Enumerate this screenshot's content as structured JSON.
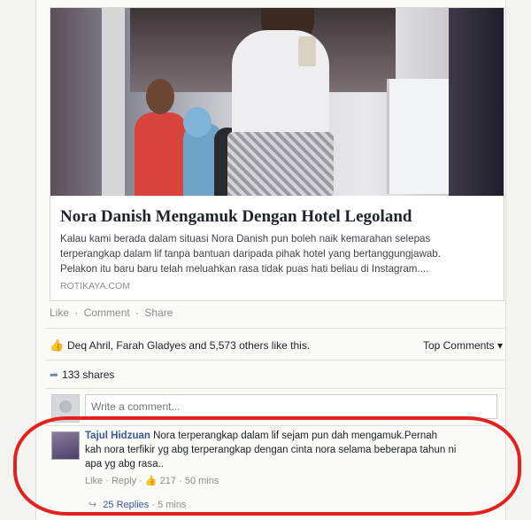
{
  "post": {
    "link_preview": {
      "title": "Nora Danish Mengamuk Dengan Hotel Legoland",
      "description_lines": [
        "Kalau kami berada dalam situasi Nora Danish pun boleh naik kemarahan selepas",
        "terperangkap dalam lif tanpa bantuan daripada pihak hotel yang bertanggungjawab.",
        "Pelakon itu baru baru telah meluahkan rasa tidak puas hati beliau di Instagram...."
      ],
      "domain": "ROTIKAYA.COM"
    },
    "actions": {
      "like": "Like",
      "comment": "Comment",
      "share": "Share",
      "separator": "·"
    },
    "likes_summary": "Deq Ahril, Farah Gladyes and 5,573 others like this.",
    "top_comments_label": "Top Comments ▾",
    "shares": "133 shares",
    "write_comment_placeholder": "Write a comment..."
  },
  "comment": {
    "author": "Tajul Hidzuan",
    "text_lines": [
      "Nora terperangkap dalam lif sejam pun dah mengamuk.Pernah",
      "kah nora terfikir yg abg terperangkap dengan cinta nora selama beberapa tahun ni",
      "apa yg abg rasa.."
    ],
    "like": "Like",
    "reply": "Reply",
    "like_count": "217",
    "time": "50 mins",
    "separator": "·"
  },
  "replies": {
    "label": "25 Replies",
    "time": "5 mins",
    "separator": "·"
  },
  "colors": {
    "link_blue": "#3b5998",
    "highlight_red": "#e0231e",
    "muted_gray": "#8a8d91"
  },
  "icons": [
    "thumbs-up-icon",
    "share-arrow-icon",
    "reply-arrow-icon",
    "avatar-icon"
  ]
}
